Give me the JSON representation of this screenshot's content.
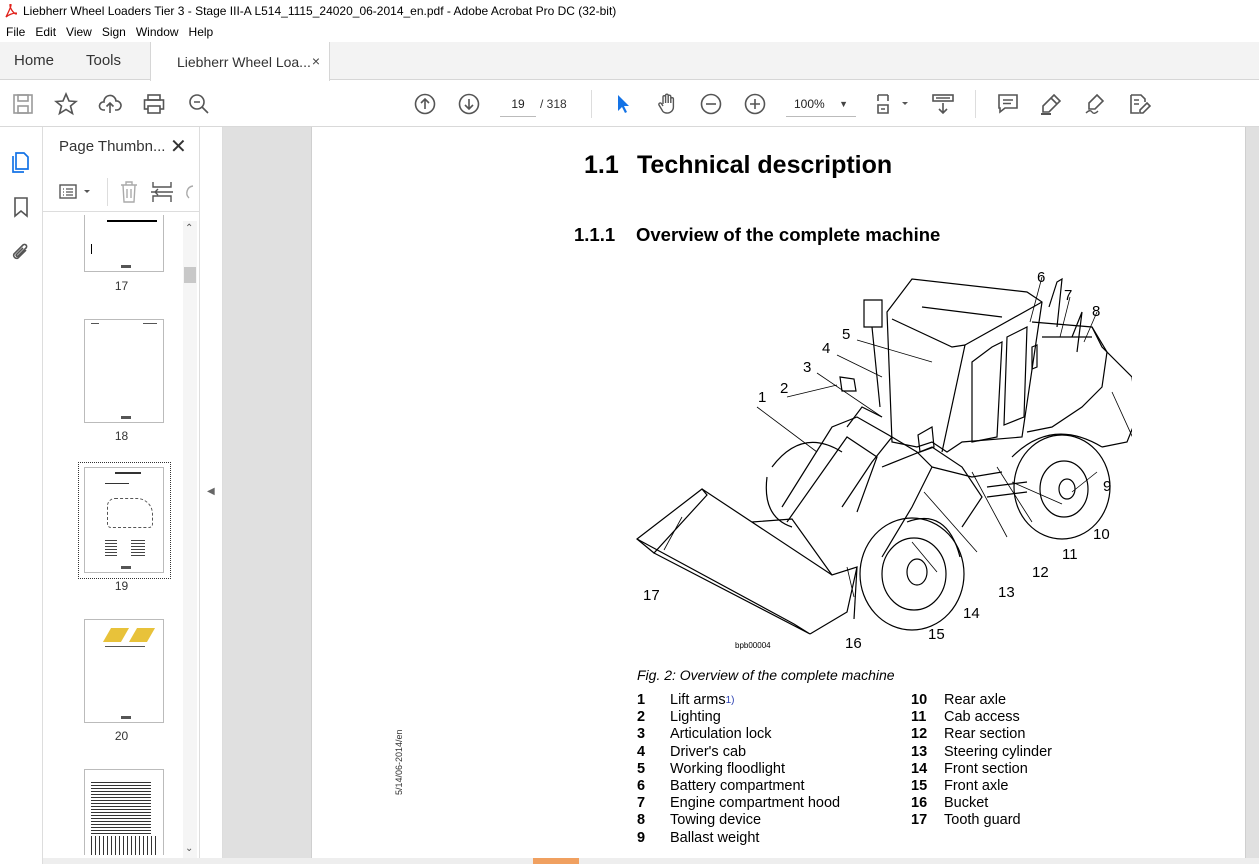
{
  "window": {
    "title": "Liebherr Wheel Loaders Tier 3 - Stage III-A L514_1115_24020_06-2014_en.pdf - Adobe Acrobat Pro DC (32-bit)"
  },
  "menu": [
    "File",
    "Edit",
    "View",
    "Sign",
    "Window",
    "Help"
  ],
  "tabs": {
    "home": "Home",
    "tools": "Tools",
    "document": "Liebherr Wheel Loa...",
    "close": "×"
  },
  "toolbar": {
    "page_current": "19",
    "page_total": "/ 318",
    "zoom": "100%",
    "icons": [
      "save-icon",
      "star-icon",
      "upload-icon",
      "print-icon",
      "zoom-search-icon",
      "page-up-icon",
      "page-down-icon",
      "select-cursor-icon",
      "hand-icon",
      "zoom-out-icon",
      "zoom-in-icon",
      "fit-page-icon",
      "scroll-mode-icon",
      "comment-icon",
      "highlight-icon",
      "sign-icon",
      "edit-pdf-icon"
    ]
  },
  "thumbnails": {
    "title": "Page Thumbn...",
    "close": "✕",
    "pages": [
      "17",
      "18",
      "19",
      "20"
    ],
    "selected": "19"
  },
  "page": {
    "h1_num": "1.1",
    "h1_text": "Technical description",
    "h2_num": "1.1.1",
    "h2_text": "Overview of the complete machine",
    "figure_id": "bpb00004",
    "figure_labels": [
      "1",
      "2",
      "3",
      "4",
      "5",
      "6",
      "7",
      "8",
      "9",
      "10",
      "11",
      "12",
      "13",
      "14",
      "15",
      "16",
      "17"
    ],
    "caption": "Fig. 2: Overview of the complete machine",
    "legend_left": [
      {
        "n": "1",
        "t": "Lift arms",
        "sup": "1)"
      },
      {
        "n": "2",
        "t": "Lighting"
      },
      {
        "n": "3",
        "t": "Articulation lock"
      },
      {
        "n": "4",
        "t": "Driver's cab"
      },
      {
        "n": "5",
        "t": "Working floodlight"
      },
      {
        "n": "6",
        "t": "Battery compartment"
      },
      {
        "n": "7",
        "t": "Engine compartment hood"
      },
      {
        "n": "8",
        "t": "Towing device"
      },
      {
        "n": "9",
        "t": "Ballast weight"
      }
    ],
    "legend_right": [
      {
        "n": "10",
        "t": "Rear axle"
      },
      {
        "n": "11",
        "t": "Cab access"
      },
      {
        "n": "12",
        "t": "Rear section"
      },
      {
        "n": "13",
        "t": "Steering cylinder"
      },
      {
        "n": "14",
        "t": "Front section"
      },
      {
        "n": "15",
        "t": "Front axle"
      },
      {
        "n": "16",
        "t": "Bucket"
      },
      {
        "n": "17",
        "t": "Tooth guard"
      }
    ],
    "sidenote": "5/14/06-2014/en"
  },
  "colors": {
    "accent": "#1473e6",
    "viewer_bg": "#e0e0e0",
    "acrobat_red": "#e0211b"
  }
}
